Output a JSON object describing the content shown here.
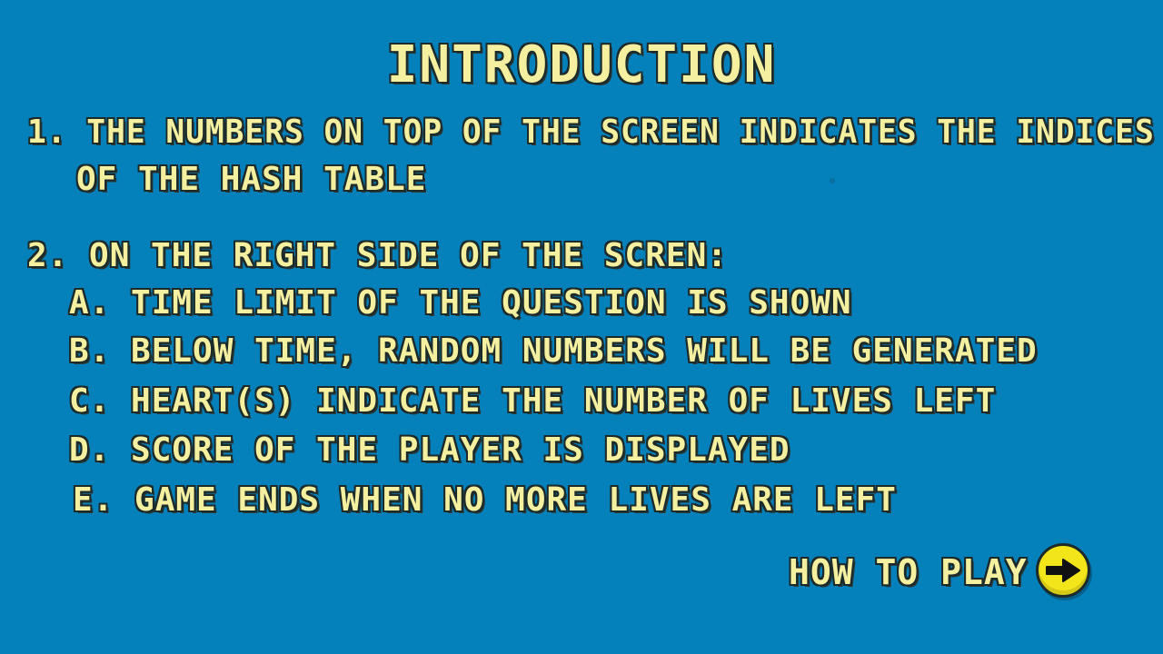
{
  "screen": {
    "title": "INTRODUCTION",
    "background_color": "#0480bb",
    "text_color": "#f5f0a0",
    "outline_color": "#1c2a2a"
  },
  "items": {
    "item1_line1": "1.  THE NUMBERS ON TOP OF THE SCREEN INDICATES THE INDICES",
    "item1_line2": "OF THE HASH TABLE",
    "item2_heading": "2. ON THE RIGHT SIDE OF THE SCREN:",
    "sub_a": "A. TIME LIMIT OF THE QUESTION IS SHOWN",
    "sub_b": "B.  BELOW TIME, RANDOM NUMBERS WILL BE GENERATED",
    "sub_c": "C.  HEART(S) INDICATE THE NUMBER OF LIVES LEFT",
    "sub_d": "D.  SCORE OF THE PLAYER IS DISPLAYED",
    "sub_e": "E.  GAME ENDS WHEN NO MORE LIVES ARE LEFT"
  },
  "navigation": {
    "next_label": "HOW TO PLAY",
    "next_icon": "arrow-right-icon",
    "button_color": "#f2e51a"
  }
}
